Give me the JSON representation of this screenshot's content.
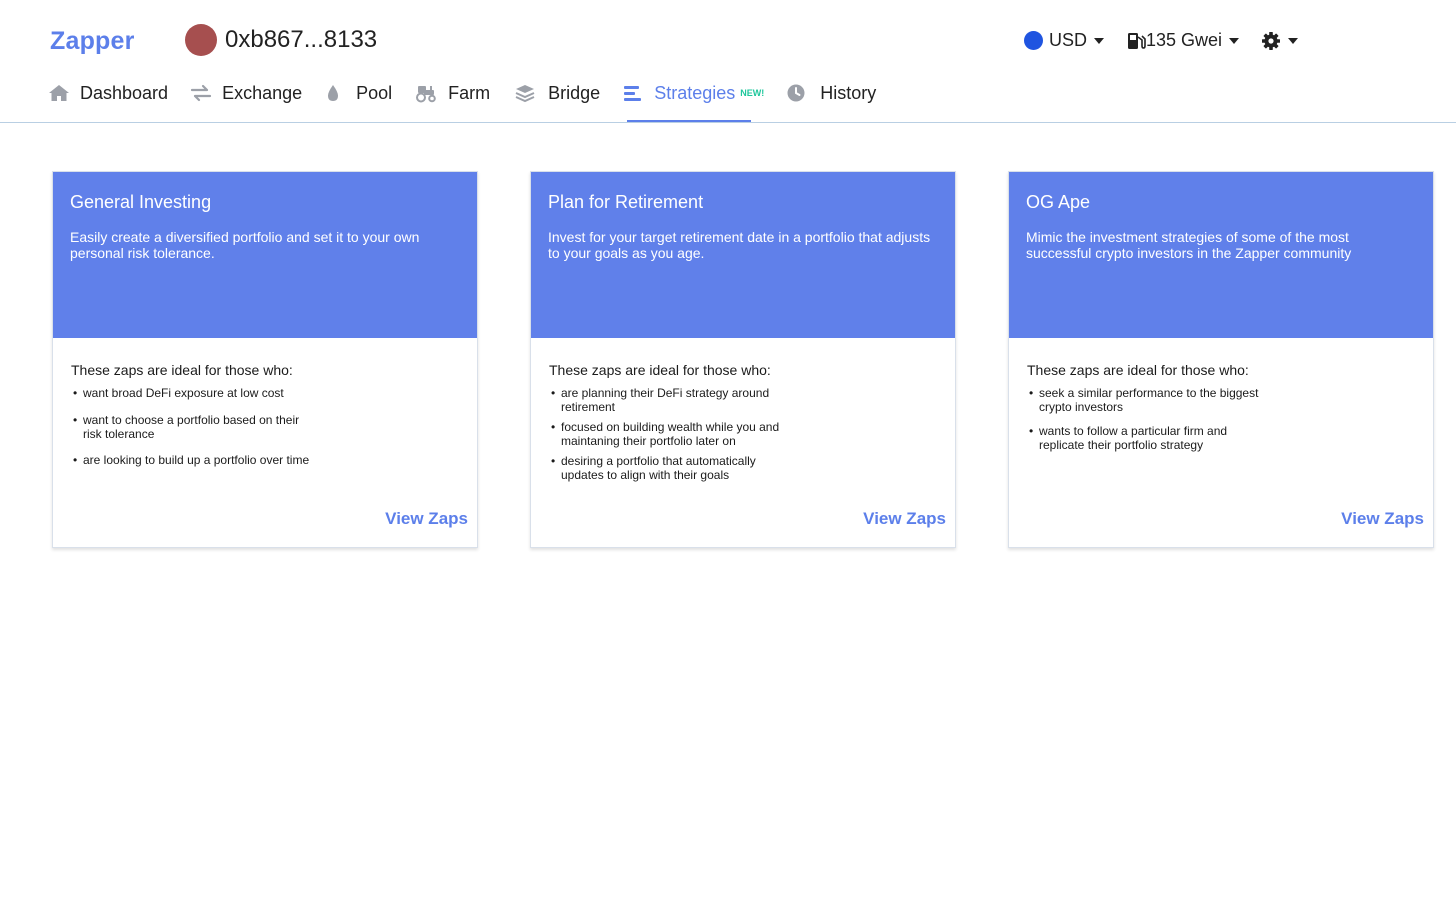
{
  "header": {
    "logo": "Zapper",
    "address": "0xb867...8133",
    "currency": "USD",
    "gas": "135 Gwei"
  },
  "nav": [
    {
      "label": "Dashboard"
    },
    {
      "label": "Exchange"
    },
    {
      "label": "Pool"
    },
    {
      "label": "Farm"
    },
    {
      "label": "Bridge"
    },
    {
      "label": "Strategies",
      "badge": "NEW!"
    },
    {
      "label": "History"
    }
  ],
  "cards": [
    {
      "title": "General Investing",
      "description": "Easily create a diversified portfolio and set it to your own personal risk tolerance.",
      "ideal": "These zaps are ideal for those who:",
      "bullets": [
        "want broad DeFi exposure at low cost",
        "want to choose a portfolio based on their risk tolerance",
        "are looking to build up a portfolio over time"
      ],
      "cta": "View Zaps"
    },
    {
      "title": "Plan for Retirement",
      "description": "Invest for your target retirement date in a portfolio that adjusts to your goals as you age.",
      "ideal": "These zaps are ideal for those who:",
      "bullets": [
        "are planning their DeFi strategy around retirement",
        "focused on building wealth while you and maintaning their portfolio later on",
        "desiring a portfolio that automatically updates to align with their goals"
      ],
      "cta": "View Zaps"
    },
    {
      "title": "OG Ape",
      "description": "Mimic the investment strategies of some of the most successful crypto investors in the Zapper community",
      "ideal": "These zaps are ideal for those who:",
      "bullets": [
        "seek a similar performance to the biggest crypto investors",
        "wants to follow a particular firm and replicate their portfolio strategy"
      ],
      "cta": "View Zaps"
    }
  ],
  "colors": {
    "accent": "#5c7fea",
    "card_header": "#6080ea",
    "new_badge": "#1fc79c",
    "avatar": "#a64f4f",
    "currency_dot": "#1f54e0"
  },
  "icons": {
    "dashboard": "home-icon",
    "exchange": "arrows-icon",
    "pool": "droplet-icon",
    "farm": "tractor-icon",
    "bridge": "layers-icon",
    "strategies": "bars-icon",
    "history": "clock-icon",
    "gas": "gas-pump-icon",
    "settings": "gear-icon"
  }
}
